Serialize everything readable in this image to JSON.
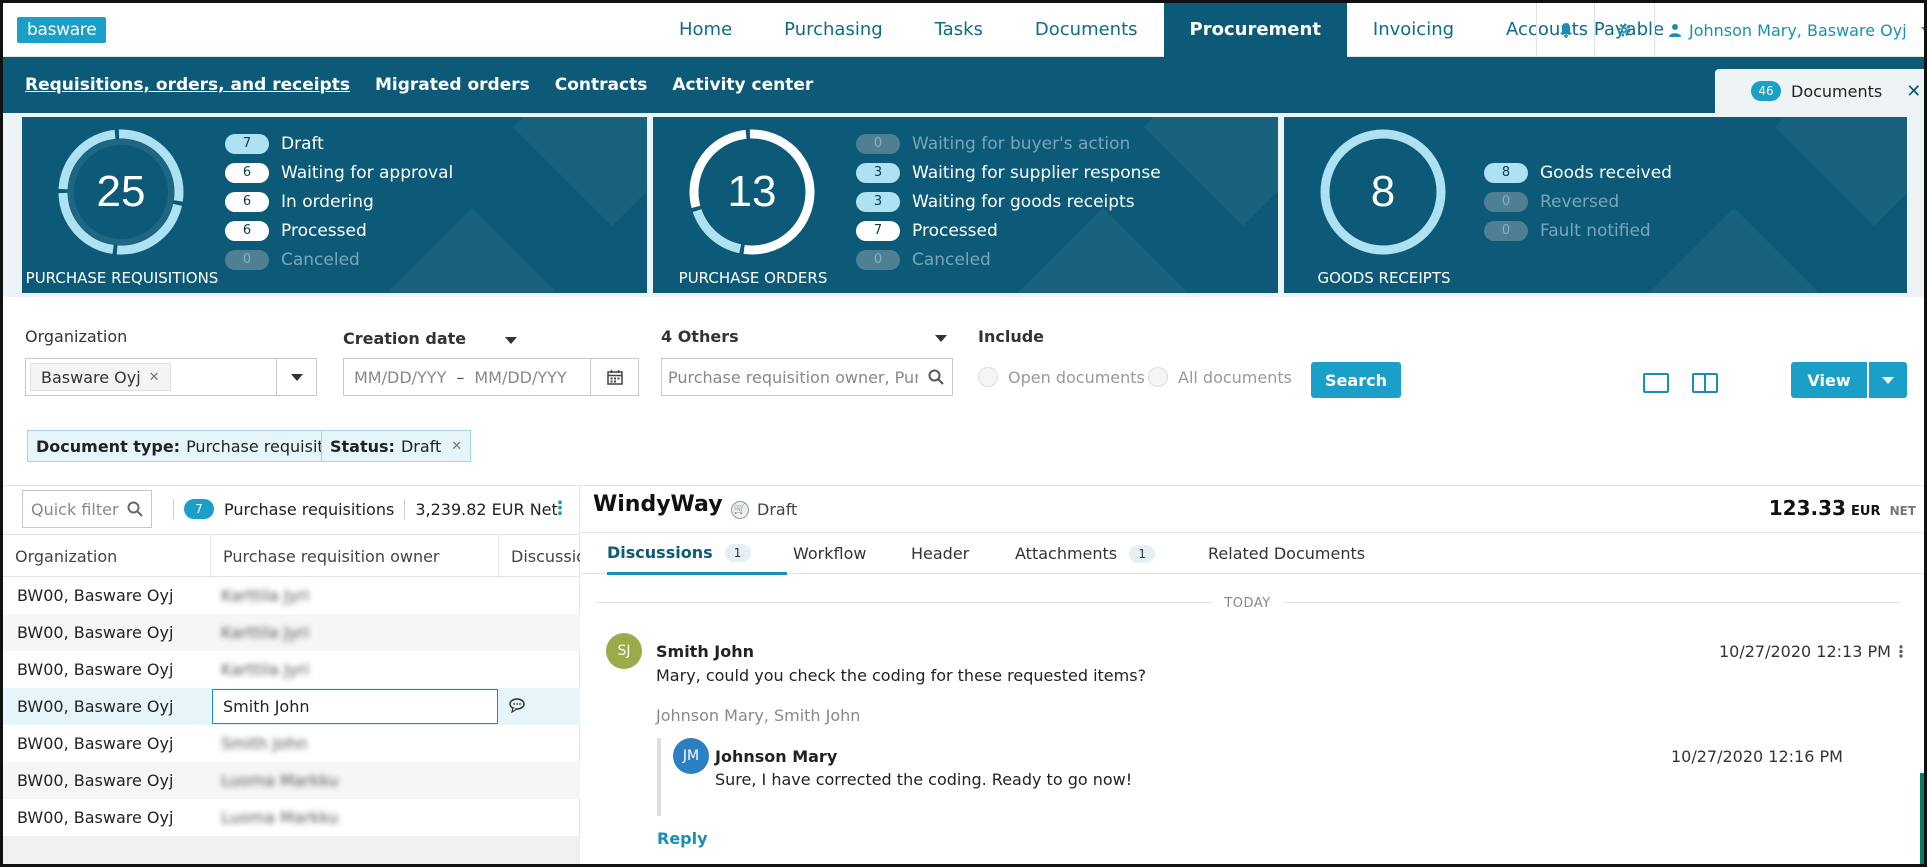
{
  "nav": {
    "logo": "basware",
    "items": [
      "Home",
      "Purchasing",
      "Tasks",
      "Documents",
      "Procurement",
      "Invoicing",
      "Accounts Payable"
    ],
    "active": "Procurement",
    "user": "Johnson Mary, Basware Oyj"
  },
  "subnav": {
    "items": [
      "Requisitions, orders, and receipts",
      "Migrated orders",
      "Contracts",
      "Activity center"
    ],
    "documents_count": "46",
    "documents_label": "Documents"
  },
  "dashboard": {
    "requisitions": {
      "total": "25",
      "title": "PURCHASE REQUISITIONS",
      "stats": [
        {
          "count": "7",
          "label": "Draft"
        },
        {
          "count": "6",
          "label": "Waiting for approval"
        },
        {
          "count": "6",
          "label": "In ordering"
        },
        {
          "count": "6",
          "label": "Processed"
        },
        {
          "count": "0",
          "label": "Canceled"
        }
      ]
    },
    "orders": {
      "total": "13",
      "title": "PURCHASE ORDERS",
      "stats": [
        {
          "count": "0",
          "label": "Waiting for buyer's action"
        },
        {
          "count": "3",
          "label": "Waiting for supplier response"
        },
        {
          "count": "3",
          "label": "Waiting for goods receipts"
        },
        {
          "count": "7",
          "label": "Processed"
        },
        {
          "count": "0",
          "label": "Canceled"
        }
      ]
    },
    "receipts": {
      "total": "8",
      "title": "GOODS RECEIPTS",
      "stats": [
        {
          "count": "8",
          "label": "Goods received"
        },
        {
          "count": "0",
          "label": "Reversed"
        },
        {
          "count": "0",
          "label": "Fault notified"
        }
      ]
    }
  },
  "filters": {
    "organization_label": "Organization",
    "organization_value": "Basware Oyj",
    "creation_date_label": "Creation date",
    "date_from_placeholder": "MM/DD/YYY",
    "date_separator": "–",
    "date_to_placeholder": "MM/DD/YYY",
    "others_label": "4 Others",
    "search_placeholder": "Purchase requisition owner, Purpose",
    "include_label": "Include",
    "open_documents": "Open documents",
    "all_documents": "All documents",
    "search_button": "Search",
    "view_button": "View",
    "tags": [
      {
        "key": "Document type:",
        "value": "Purchase requisition",
        "removable": false
      },
      {
        "key": "Status:",
        "value": "Draft",
        "removable": true
      }
    ]
  },
  "list": {
    "quick_filter_placeholder": "Quick filter",
    "count": "7",
    "count_label": "Purchase requisitions",
    "total": "3,239.82 EUR Net",
    "columns": [
      "Organization",
      "Purchase requisition owner",
      "Discussions"
    ],
    "rows": [
      {
        "org": "BW00, Basware Oyj",
        "owner": "Karttila Jyri"
      },
      {
        "org": "BW00, Basware Oyj",
        "owner": "Karttila Jyri"
      },
      {
        "org": "BW00, Basware Oyj",
        "owner": "Karttila Jyri"
      },
      {
        "org": "BW00, Basware Oyj",
        "owner": "Smith John"
      },
      {
        "org": "BW00, Basware Oyj",
        "owner": "Smith John"
      },
      {
        "org": "BW00, Basware Oyj",
        "owner": "Luoma Markku"
      },
      {
        "org": "BW00, Basware Oyj",
        "owner": "Luoma Markku"
      }
    ]
  },
  "detail": {
    "title": "WindyWay",
    "status": "Draft",
    "amount": "123.33",
    "currency": "EUR",
    "net_label": "NET",
    "tabs": [
      {
        "label": "Discussions",
        "count": "1"
      },
      {
        "label": "Workflow",
        "count": ""
      },
      {
        "label": "Header",
        "count": ""
      },
      {
        "label": "Attachments",
        "count": "1"
      },
      {
        "label": "Related Documents",
        "count": ""
      }
    ],
    "today_label": "TODAY",
    "message": {
      "initials": "SJ",
      "author": "Smith John",
      "text": "Mary, could you check the coding for these requested items?",
      "time": "10/27/2020 12:13 PM",
      "participants": "Johnson Mary, Smith John"
    },
    "reply": {
      "initials": "JM",
      "author": "Johnson Mary",
      "text": "Sure, I have corrected the coding. Ready to go now!",
      "time": "10/27/2020 12:16 PM"
    },
    "reply_link": "Reply"
  },
  "colors": {
    "brand": "#1aa0c8",
    "navy": "#0c5a78",
    "avatar_sj": "#9bab4a",
    "avatar_jm": "#2d7fc4"
  }
}
